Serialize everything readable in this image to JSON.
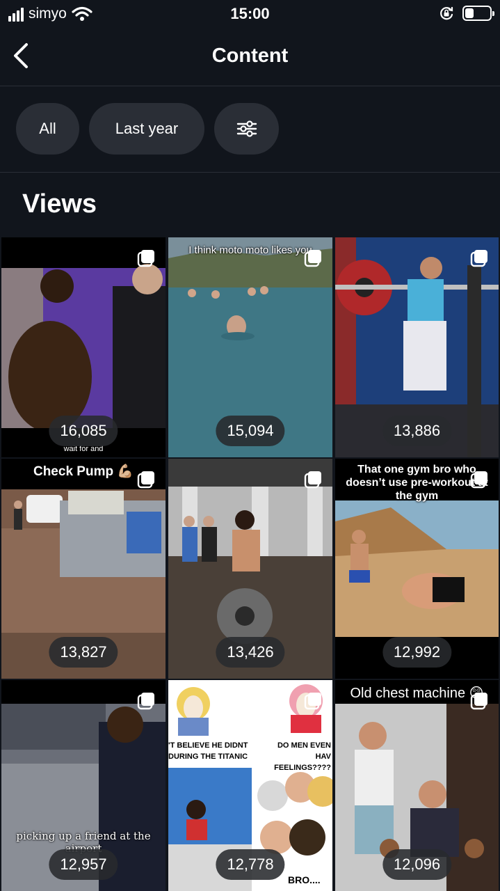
{
  "status_bar": {
    "carrier": "simyo",
    "time": "15:00"
  },
  "nav": {
    "title": "Content"
  },
  "filters": {
    "all_label": "All",
    "period_label": "Last year"
  },
  "section": {
    "title": "Views"
  },
  "posts": [
    {
      "views": "16,085",
      "caption_bottom": "wait for and"
    },
    {
      "views": "15,094",
      "caption_top": "I think moto moto likes you"
    },
    {
      "views": "13,886"
    },
    {
      "views": "13,827",
      "caption_top": "Check Pump 💪🏼"
    },
    {
      "views": "13,426"
    },
    {
      "views": "12,992",
      "caption_top": "That one gym bro who doesn’t use pre-workout at the gym"
    },
    {
      "views": "12,957",
      "caption_bottom": "picking up a friend at the airport"
    },
    {
      "views": "12,778",
      "meme_left": "'T BELIEVE HE DIDNT DURING THE TITANIC",
      "meme_right": "DO MEN EVEN HAV FEELINGS????",
      "meme_bottom": "BRO...."
    },
    {
      "views": "12,096",
      "caption_top": "Old chest machine 😲"
    }
  ],
  "colors": {
    "background": "#11151c",
    "chip": "#2a2e36",
    "divider": "#2a2f37"
  }
}
